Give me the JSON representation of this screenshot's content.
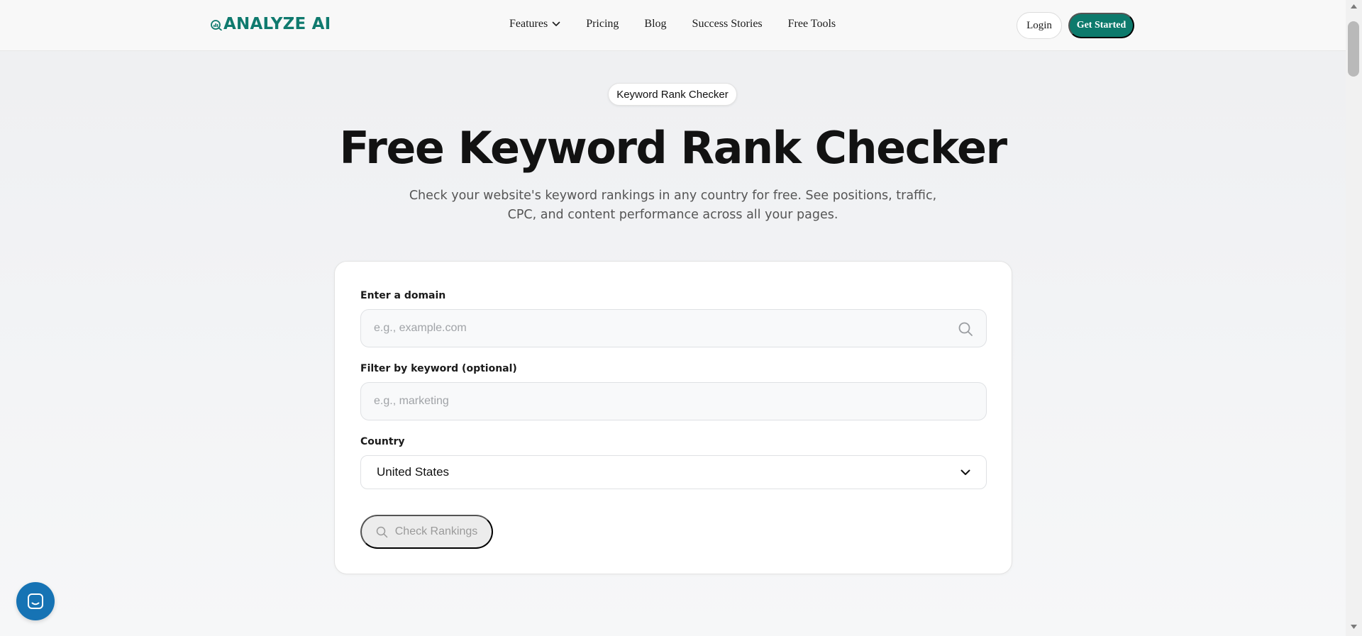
{
  "nav": {
    "logo_text": "ANALYZE AI",
    "links": [
      {
        "label": "Features",
        "has_dropdown": true
      },
      {
        "label": "Pricing"
      },
      {
        "label": "Blog"
      },
      {
        "label": "Success Stories"
      },
      {
        "label": "Free Tools"
      }
    ],
    "login_label": "Login",
    "get_started_label": "Get Started"
  },
  "hero": {
    "badge": "Keyword Rank Checker",
    "title": "Free Keyword Rank Checker",
    "subtitle": "Check your website's keyword rankings in any country for free. See positions, traffic, CPC, and content performance across all your pages."
  },
  "form": {
    "domain_label": "Enter a domain",
    "domain_placeholder": "e.g., example.com",
    "domain_value": "",
    "keyword_label": "Filter by keyword (optional)",
    "keyword_placeholder": "e.g., marketing",
    "keyword_value": "",
    "country_label": "Country",
    "country_value": "United States",
    "submit_label": "Check Rankings"
  },
  "icons": {
    "logo": "chart-icon",
    "dropdown": "chevron-down-icon",
    "domain_search": "search-icon",
    "button_search": "search-icon",
    "chat": "chat-icon"
  },
  "colors": {
    "brand": "#0d7a6c",
    "chat": "#1673b4",
    "disabled_button": "#ececec"
  }
}
